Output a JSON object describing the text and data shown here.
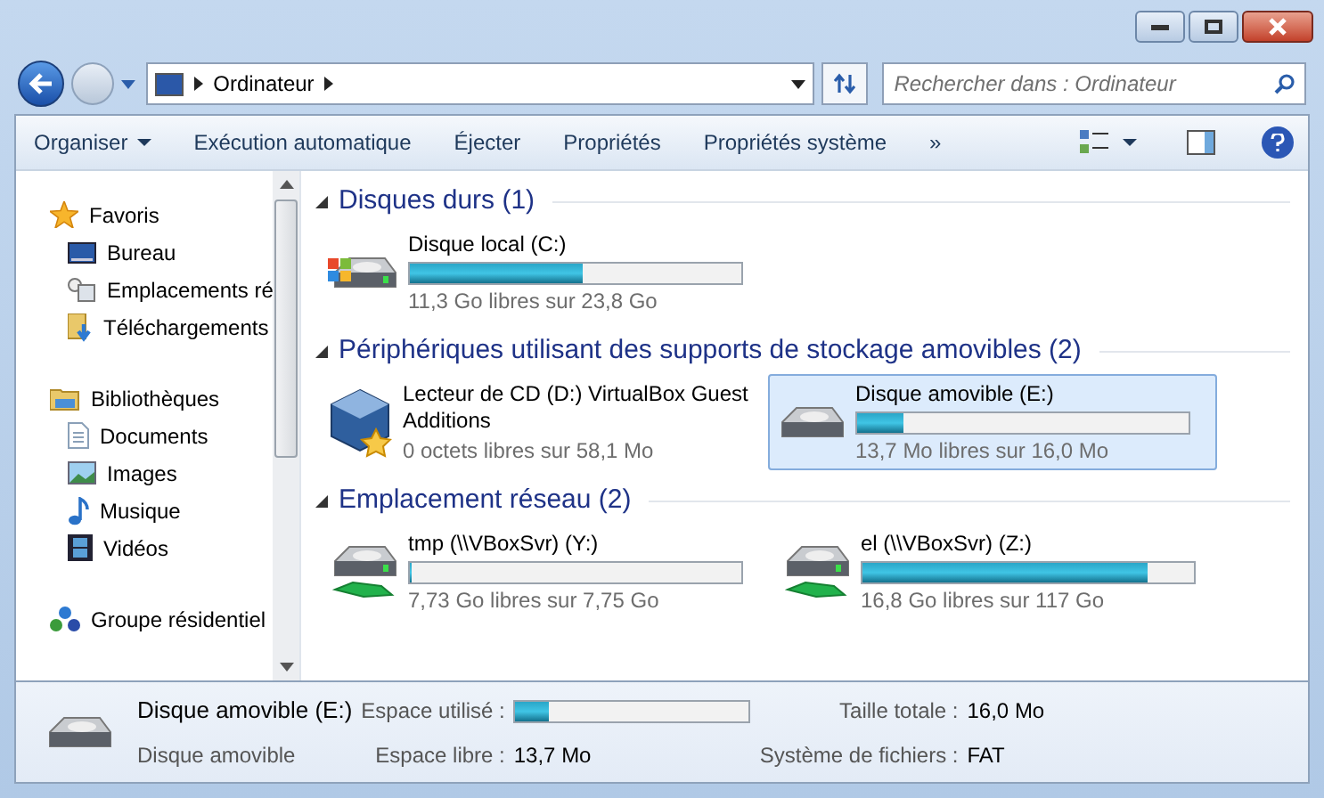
{
  "address_bar": {
    "crumbs": [
      "Ordinateur"
    ]
  },
  "search": {
    "placeholder": "Rechercher dans : Ordinateur"
  },
  "toolbar": [
    {
      "label": "Organiser",
      "kind": "menu"
    },
    {
      "label": "Exécution automatique",
      "kind": "plain"
    },
    {
      "label": "Éjecter",
      "kind": "plain"
    },
    {
      "label": "Propriétés",
      "kind": "plain"
    },
    {
      "label": "Propriétés système",
      "kind": "plain"
    },
    {
      "label": "»",
      "kind": "plain"
    }
  ],
  "sidebar": {
    "groups": [
      {
        "label": "Favoris",
        "kind": "star",
        "children": [
          {
            "label": "Bureau",
            "kind": "desktop"
          },
          {
            "label": "Emplacements ré",
            "kind": "places"
          },
          {
            "label": "Téléchargements",
            "kind": "download"
          }
        ]
      },
      {
        "label": "Bibliothèques",
        "kind": "library",
        "children": [
          {
            "label": "Documents",
            "kind": "doc"
          },
          {
            "label": "Images",
            "kind": "image"
          },
          {
            "label": "Musique",
            "kind": "music"
          },
          {
            "label": "Vidéos",
            "kind": "video"
          }
        ]
      },
      {
        "label": "Groupe résidentiel",
        "kind": "homegroup"
      }
    ]
  },
  "sections": [
    {
      "title": "Disques durs (1)",
      "items": [
        {
          "name": "Disque local (C:)",
          "kind": "system",
          "level": 0.52,
          "free": "11,3 Go libres sur 23,8 Go",
          "selected": false
        }
      ]
    },
    {
      "title": "Périphériques utilisant des supports de stockage amovibles (2)",
      "items": [
        {
          "name": "Lecteur de CD (D:) VirtualBox Guest Additions",
          "kind": "cd",
          "free": "0 octets libres sur 58,1 Mo",
          "selected": false
        },
        {
          "name": "Disque amovible (E:)",
          "kind": "removable",
          "level": 0.14,
          "free": "13,7 Mo libres sur 16,0 Mo",
          "selected": true
        }
      ]
    },
    {
      "title": "Emplacement réseau (2)",
      "items": [
        {
          "name": "tmp (\\\\VBoxSvr) (Y:)",
          "kind": "network",
          "level": 0.003,
          "free": "7,73 Go libres sur 7,75 Go",
          "selected": false
        },
        {
          "name": "el (\\\\VBoxSvr) (Z:)",
          "kind": "network",
          "level": 0.86,
          "free": "16,8 Go libres sur 117 Go",
          "selected": false
        }
      ]
    }
  ],
  "details": {
    "name": "Disque amovible (E:)",
    "type": "Disque amovible",
    "used_label": "Espace utilisé :",
    "level": 0.14,
    "free_label": "Espace libre :",
    "free": "13,7 Mo",
    "total_label": "Taille totale :",
    "total": "16,0 Mo",
    "fs_label": "Système de fichiers :",
    "fs": "FAT"
  }
}
